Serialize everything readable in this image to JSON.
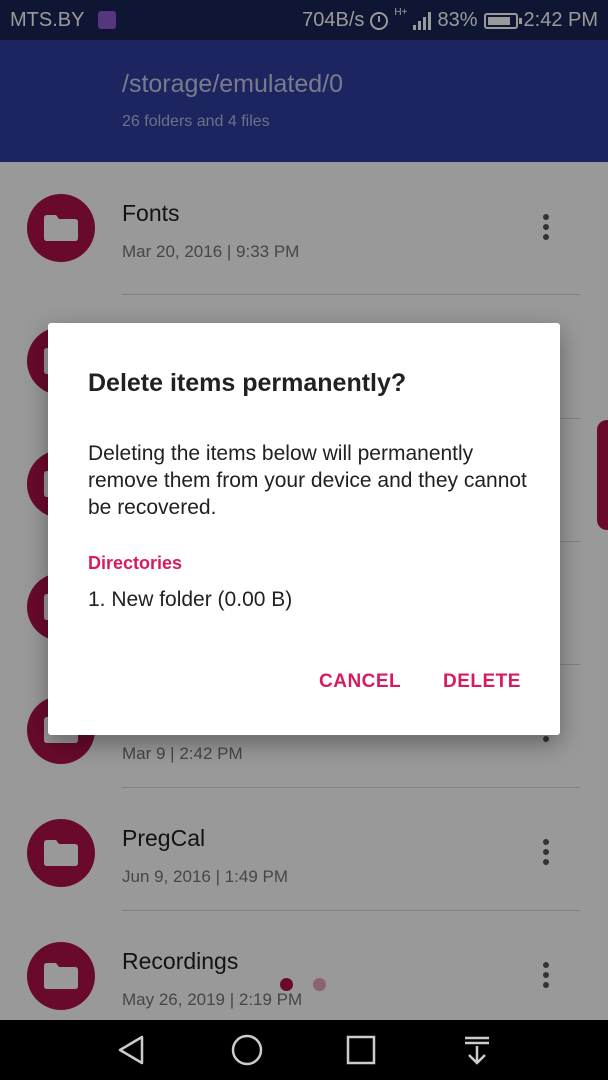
{
  "status_bar": {
    "carrier": "MTS.BY",
    "speed": "704B/s",
    "network": "H+",
    "battery": "83%",
    "time": "2:42 PM"
  },
  "header": {
    "path": "/storage/emulated/0",
    "subtitle": "26 folders and 4 files"
  },
  "list": {
    "items": [
      {
        "name": "Fonts",
        "date": "Mar 20, 2016 | 9:33 PM"
      },
      {
        "name": "",
        "date": ""
      },
      {
        "name": "",
        "date": ""
      },
      {
        "name": "",
        "date": ""
      },
      {
        "name": "",
        "date": "Mar 9 | 2:42 PM"
      },
      {
        "name": "PregCal",
        "date": "Jun 9, 2016 | 1:49 PM"
      },
      {
        "name": "Recordings",
        "date": "May 26, 2019 | 2:19 PM"
      }
    ]
  },
  "dialog": {
    "title": "Delete items permanently?",
    "message": "Deleting the items below will permanently remove them from your device and they cannot be recovered.",
    "section_label": "Directories",
    "item": "1. New folder (0.00 B)",
    "cancel_label": "CANCEL",
    "delete_label": "DELETE"
  },
  "colors": {
    "accent": "#d81b60",
    "avatar": "#b0114b",
    "header": "#2f3e9e",
    "status_bar": "#1a2558"
  },
  "icons": {
    "folder": "folder-icon",
    "more": "more-vert-icon",
    "back": "back-icon",
    "home": "home-icon",
    "recents": "recents-icon",
    "notifications": "notification-pulldown-icon"
  }
}
